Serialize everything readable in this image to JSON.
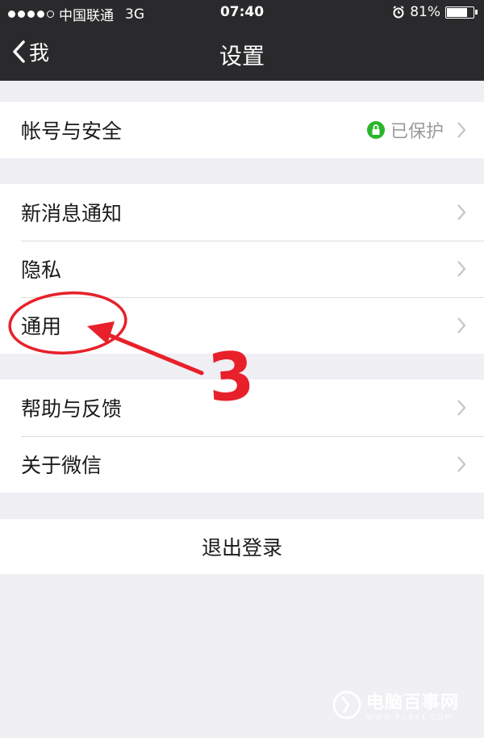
{
  "status_bar": {
    "carrier": "中国联通",
    "network": "3G",
    "time": "07:40",
    "battery": "81%",
    "battery_level": 0.81
  },
  "nav": {
    "back_label": "我",
    "title": "设置"
  },
  "account": {
    "label": "帐号与安全",
    "status": "已保护",
    "status_color": "#2bb52b"
  },
  "group2": {
    "items": [
      {
        "label": "新消息通知"
      },
      {
        "label": "隐私"
      },
      {
        "label": "通用"
      }
    ]
  },
  "group3": {
    "items": [
      {
        "label": "帮助与反馈"
      },
      {
        "label": "关于微信"
      }
    ]
  },
  "logout": {
    "label": "退出登录"
  },
  "annotation": {
    "step_number": "3",
    "color": "#e8202a"
  },
  "watermark": {
    "main": "电脑百事网",
    "sub": "WWW.PC841.COM"
  }
}
